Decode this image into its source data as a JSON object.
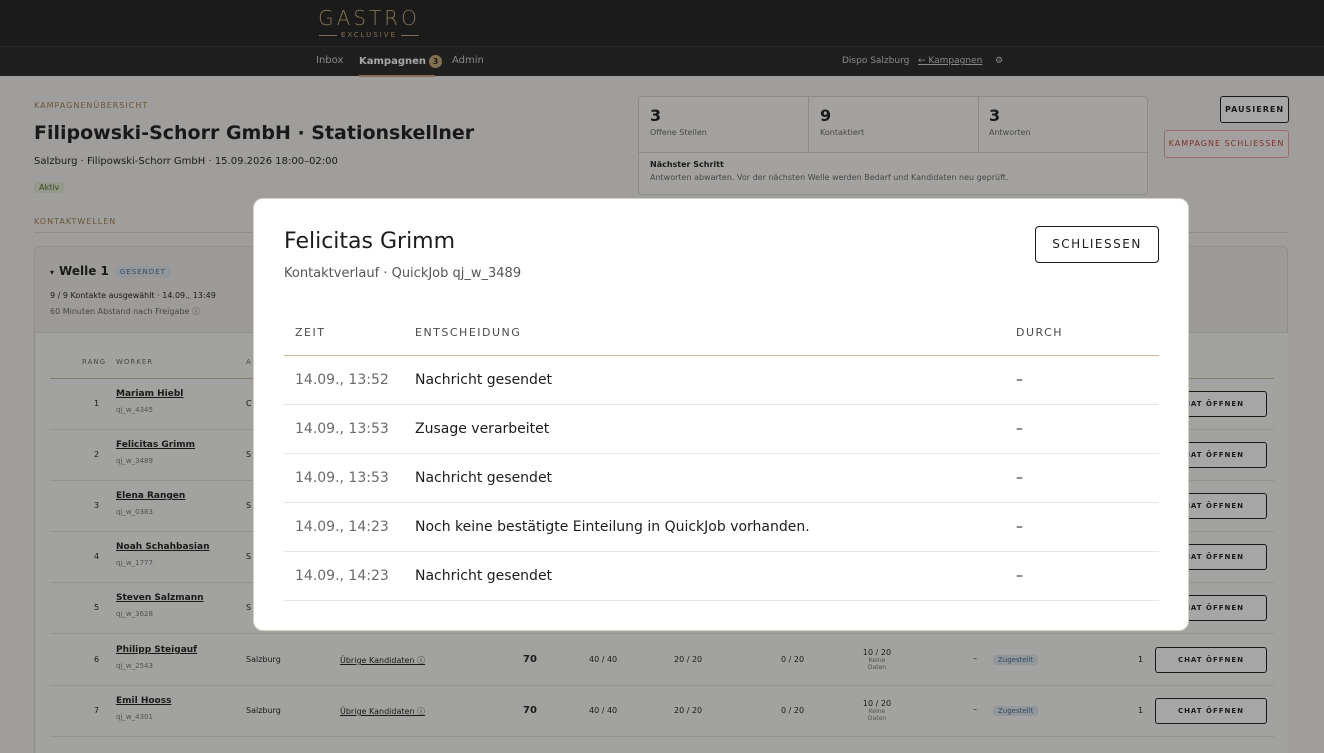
{
  "header": {
    "logo_main": "GASTRO",
    "logo_sub": "EXCLUSIVE",
    "nav": [
      {
        "label": "Inbox"
      },
      {
        "label": "Kampagnen",
        "badge": "3"
      },
      {
        "label": "Admin"
      }
    ],
    "location": "Dispo Salzburg",
    "back_link": "← Kampagnen",
    "settings_icon": "gear-icon"
  },
  "page": {
    "kicker": "KAMPAGNENÜBERSICHT",
    "title": "Filipowski-Schorr GmbH · Stationskellner",
    "subtitle": "Salzburg · Filipowski-Schorr GmbH · 15.09.2026 18:00–02:00",
    "status": "Aktiv",
    "section_label": "KONTAKTWELLEN"
  },
  "stats": [
    {
      "value": "3",
      "label": "Offene Stellen"
    },
    {
      "value": "9",
      "label": "Kontaktiert"
    },
    {
      "value": "3",
      "label": "Antworten"
    }
  ],
  "next_step": {
    "title": "Nächster Schritt",
    "text": "Antworten abwarten. Vor der nächsten Welle werden Bedarf und Kandidaten neu geprüft."
  },
  "actions": {
    "pause": "PAUSIEREN",
    "close_campaign": "KAMPAGNE SCHLIESSEN"
  },
  "wave": {
    "title": "Welle 1",
    "badge": "GESENDET",
    "meta1": "9 / 9 Kontakte ausgewählt · 14.09., 13:49",
    "meta2": "60 Minuten Abstand nach Freigabe ⓘ",
    "columns": [
      "RANG",
      "WORKER",
      "A"
    ],
    "rows": [
      {
        "rank": "1",
        "name": "Mariam Hiebl",
        "id": "qj_w_4345",
        "city": "C",
        "chat": "CHAT ÖFFNEN"
      },
      {
        "rank": "2",
        "name": "Felicitas Grimm",
        "id": "qj_w_3489",
        "city": "S",
        "chat": "CHAT ÖFFNEN"
      },
      {
        "rank": "3",
        "name": "Elena Rangen",
        "id": "qj_w_0383",
        "city": "S",
        "chat": "CHAT ÖFFNEN"
      },
      {
        "rank": "4",
        "name": "Noah Schahbasian",
        "id": "qj_w_1777",
        "city": "S",
        "chat": "CHAT ÖFFNEN"
      },
      {
        "rank": "5",
        "name": "Steven Salzmann",
        "id": "qj_w_3628",
        "city": "S",
        "chat": "CHAT ÖFFNEN"
      },
      {
        "rank": "6",
        "name": "Philipp Steigauf",
        "id": "qj_w_2543",
        "city": "Salzburg",
        "group": "Übrige Kandidaten ⓘ",
        "score": "70",
        "c1": "40 / 40",
        "c2": "20 / 20",
        "c3": "0 / 20",
        "c4": "10 / 20",
        "c4_note": "Keine Daten",
        "dash": "–",
        "status": "Zugestellt",
        "one": "1",
        "chat": "CHAT ÖFFNEN"
      },
      {
        "rank": "7",
        "name": "Emil Hooss",
        "id": "qj_w_4301",
        "city": "Salzburg",
        "group": "Übrige Kandidaten ⓘ",
        "score": "70",
        "c1": "40 / 40",
        "c2": "20 / 20",
        "c3": "0 / 20",
        "c4": "10 / 20",
        "c4_note": "Keine Daten",
        "dash": "–",
        "status": "Zugestellt",
        "one": "1",
        "chat": "CHAT ÖFFNEN"
      }
    ]
  },
  "modal": {
    "title": "Felicitas Grimm",
    "subtitle": "Kontaktverlauf · QuickJob qj_w_3489",
    "close": "SCHLIESSEN",
    "columns": [
      "ZEIT",
      "ENTSCHEIDUNG",
      "DURCH"
    ],
    "rows": [
      {
        "time": "14.09., 13:52",
        "decision": "Nachricht gesendet",
        "by": "–"
      },
      {
        "time": "14.09., 13:53",
        "decision": "Zusage verarbeitet",
        "by": "–"
      },
      {
        "time": "14.09., 13:53",
        "decision": "Nachricht gesendet",
        "by": "–"
      },
      {
        "time": "14.09., 14:23",
        "decision": "Noch keine bestätigte Einteilung in QuickJob vorhanden.",
        "by": "–"
      },
      {
        "time": "14.09., 14:23",
        "decision": "Nachricht gesendet",
        "by": "–"
      }
    ]
  }
}
